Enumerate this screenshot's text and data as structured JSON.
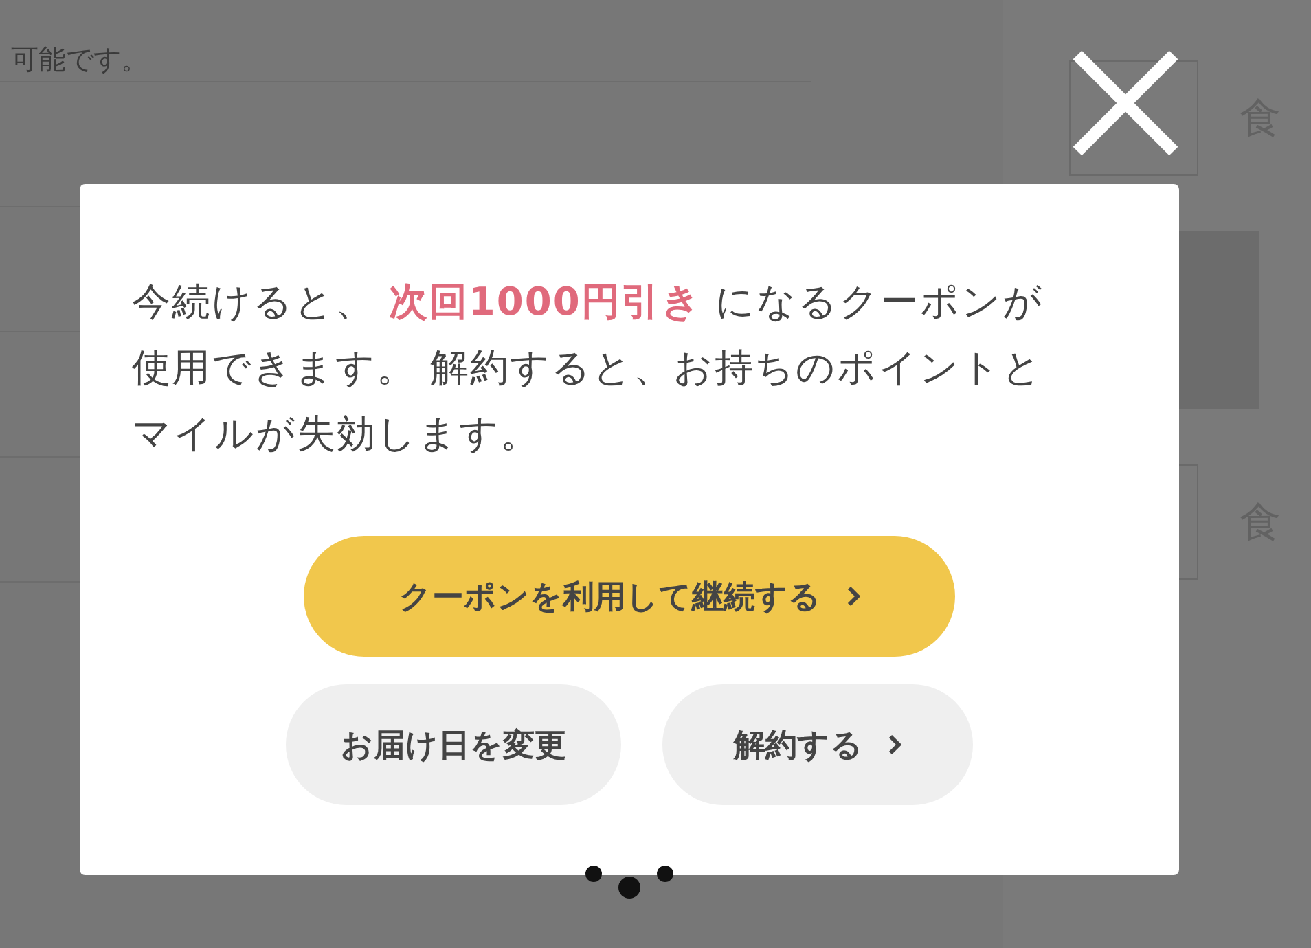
{
  "background": {
    "notice": "可能です。",
    "side_labels": [
      "食",
      "食"
    ]
  },
  "dialog": {
    "message": "今続けると、 **次回1000円引き** になるクーポンが使用できます。 解約すると、お持ちのポイントとマイルが失効します。",
    "buttons": [
      {
        "label": "クーポンを利用して継続する",
        "kind": "primary",
        "chevron": true
      },
      {
        "label": "お届け日を変更",
        "kind": "secondary",
        "chevron": false
      },
      {
        "label": "解約する",
        "kind": "secondary",
        "chevron": true
      }
    ]
  }
}
